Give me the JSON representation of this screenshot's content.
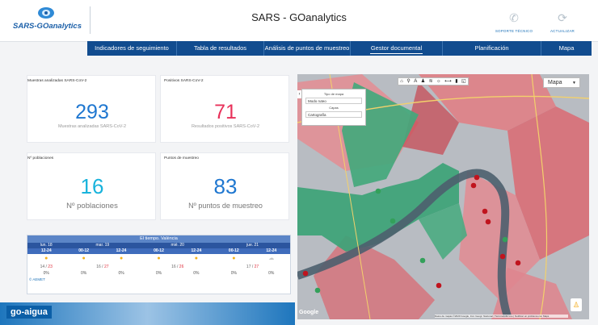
{
  "app": {
    "logo_text": "SARS-GOanalytics",
    "title": "SARS - GOanalytics"
  },
  "header_actions": [
    {
      "icon": "phone-icon",
      "label": "SOPORTE TÉCNICO"
    },
    {
      "icon": "refresh-icon",
      "label": "ACTUALIZAR"
    }
  ],
  "nav": {
    "items": [
      "Indicadores de seguimiento",
      "Tabla de resultados",
      "Análisis de puntos de muestreo",
      "Gestor documental",
      "Planificación",
      "Mapa"
    ],
    "active": "Gestor documental"
  },
  "kpis": [
    {
      "header": "Muestras analizadas SARS-CoV-2",
      "value": "293",
      "caption": "Muestras analizadas SARS-CoV-2",
      "color": "#1f77d0"
    },
    {
      "header": "Positivos SARS-CoV-2",
      "value": "71",
      "caption": "Resultados positivos SARS-CoV-2",
      "color": "#e8315a"
    },
    {
      "header": "Nº poblaciones",
      "value": "16",
      "caption": "Nº poblaciones",
      "color": "#19b3dc"
    },
    {
      "header": "Puntos de muestreo",
      "value": "83",
      "caption": "Nº puntos de muestreo",
      "color": "#1f77d0"
    }
  ],
  "weather": {
    "title": "El tiempo. València",
    "days": [
      "lun. 18",
      "mar. 19",
      "mié. 20",
      "jue. 21"
    ],
    "hours": [
      "12-24",
      "00-12",
      "12-24",
      "00-12",
      "12-24",
      "00-12",
      "12-24"
    ],
    "temps": [
      {
        "min": "14",
        "max": "23"
      },
      {
        "min": "16",
        "max": "27"
      },
      {
        "min": "16",
        "max": "26"
      },
      {
        "min": "17",
        "max": "27"
      }
    ],
    "precip": [
      "0%",
      "0%",
      "0%",
      "0%",
      "0%",
      "0%",
      "0%"
    ],
    "source": "© AEMET"
  },
  "map": {
    "type_label": "Mapa",
    "panel": {
      "tipo_label": "Tipo de mapa",
      "tipo_value": "Modo ruteo",
      "capa_label": "Capas",
      "capa_value": "Cartografía"
    },
    "google": "Google",
    "toolbar_icons": [
      "home-icon",
      "pin-icon",
      "text-icon",
      "person-icon",
      "layers-icon",
      "sun-icon",
      "measure-icon",
      "chart-icon",
      "area-icon"
    ],
    "attribution": "Datos de mapas ©2020 Google, Inst. Geogr. Nacional | Términos de uso | Notificar un problema con Maps"
  },
  "footer": {
    "brand": "go-aigua"
  }
}
